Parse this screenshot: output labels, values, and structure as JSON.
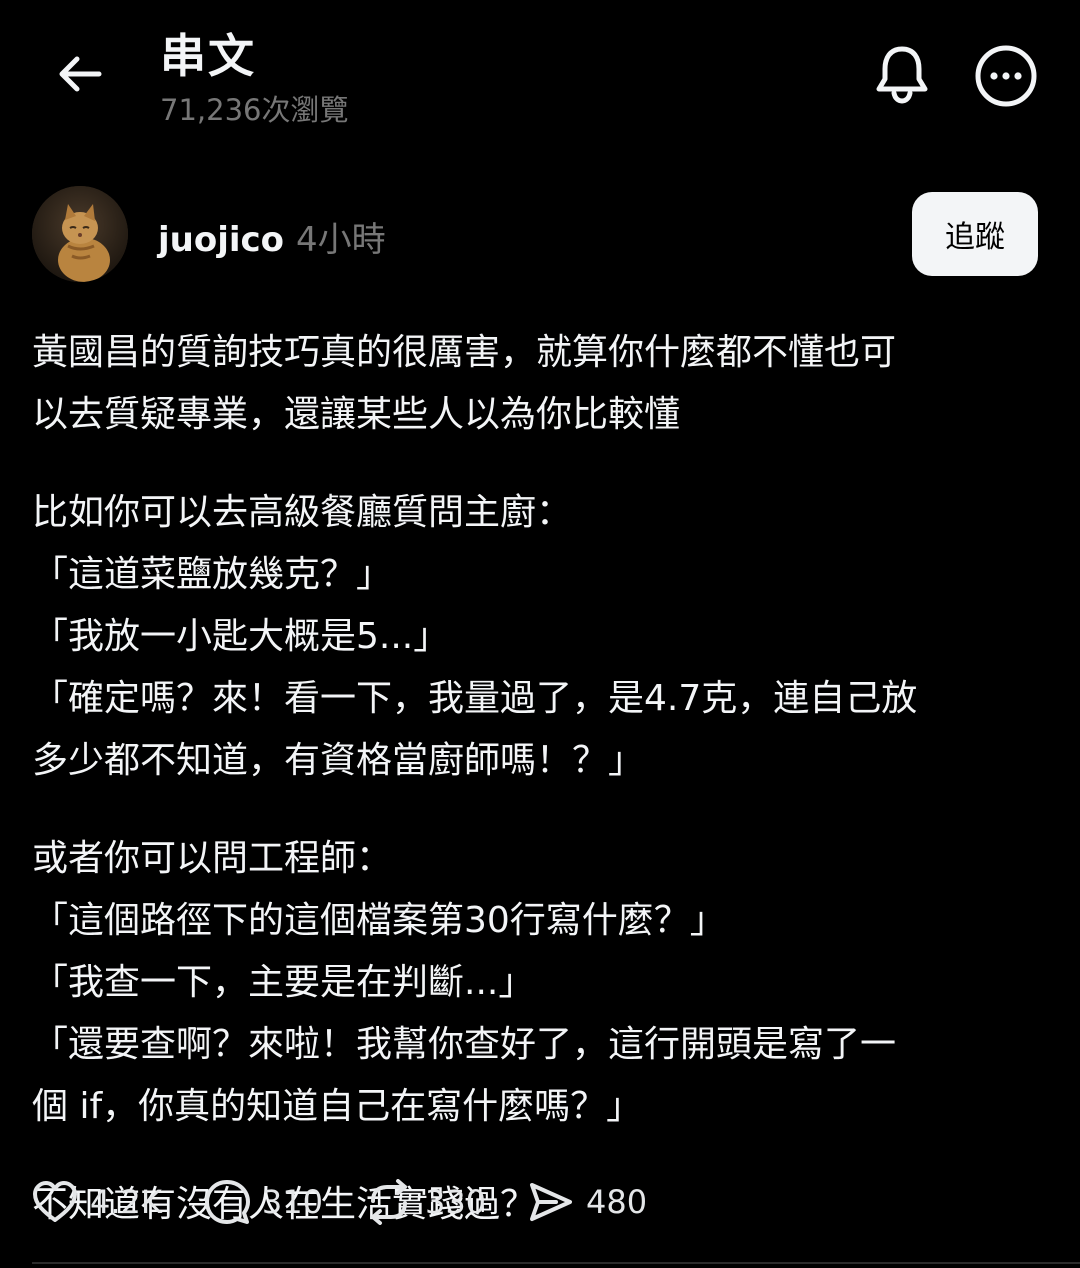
{
  "header": {
    "title": "串文",
    "views": "71,236次瀏覽"
  },
  "post": {
    "author": "juojico",
    "time": "4小時",
    "follow_label": "追蹤",
    "paragraphs": [
      [
        "黃國昌的質詢技巧真的很厲害，就算你什麼都不懂也可",
        "以去質疑專業，還讓某些人以為你比較懂"
      ],
      [
        "比如你可以去高級餐廳質問主廚：",
        "「這道菜鹽放幾克？」",
        "「我放一小匙大概是5...」",
        "「確定嗎？來！看一下，我量過了，是4.7克，連自己放",
        "多少都不知道，有資格當廚師嗎！？」"
      ],
      [
        "或者你可以問工程師：",
        "「這個路徑下的這個檔案第30行寫什麼？」",
        "「我查一下，主要是在判斷...」",
        "「還要查啊？來啦！我幫你查好了，這行開頭是寫了一",
        "個 if，你真的知道自己在寫什麼嗎？」"
      ],
      [
        "不知道有沒有人在生活實踐過？"
      ]
    ]
  },
  "actions": {
    "likes": "4.2K",
    "comments": "310",
    "reposts": "330",
    "shares": "480"
  },
  "icons": {
    "back": "arrow-left-icon",
    "notifications": "bell-icon",
    "more": "more-icon",
    "like": "heart-icon",
    "comment": "comment-icon",
    "repost": "repost-icon",
    "share": "send-icon"
  },
  "colors": {
    "background": "#000000",
    "text": "#f3f5f7",
    "secondary_text": "#777777",
    "follow_button_bg": "#f3f5f7"
  }
}
